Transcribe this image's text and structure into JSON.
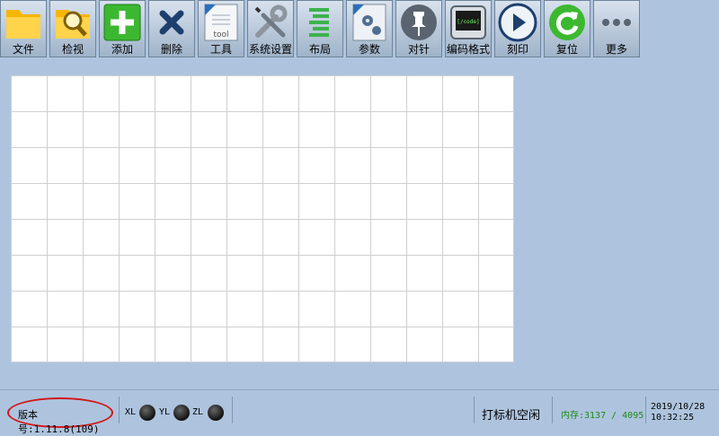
{
  "toolbar": {
    "file": "文件",
    "inspect": "检视",
    "add": "添加",
    "delete": "删除",
    "tools": "工具",
    "tools_icon_text": "tool",
    "settings": "系统设置",
    "layout": "布局",
    "params": "参数",
    "align": "对针",
    "encoding": "编码格式",
    "encoding_icon_text": "[/code]",
    "engrave": "刻印",
    "reset": "复位",
    "more": "更多"
  },
  "status": {
    "version": "版本号:1.11.8(109)",
    "axes": [
      "XL",
      "YL",
      "ZL"
    ],
    "machine_state": "打标机空闲",
    "memory": "内存:3137 / 4095",
    "date": "2019/10/28",
    "time": "10:32:25"
  },
  "colors": {
    "background": "#aec4de",
    "memory_text": "#1a8a1a",
    "version_highlight": "#d01818"
  }
}
